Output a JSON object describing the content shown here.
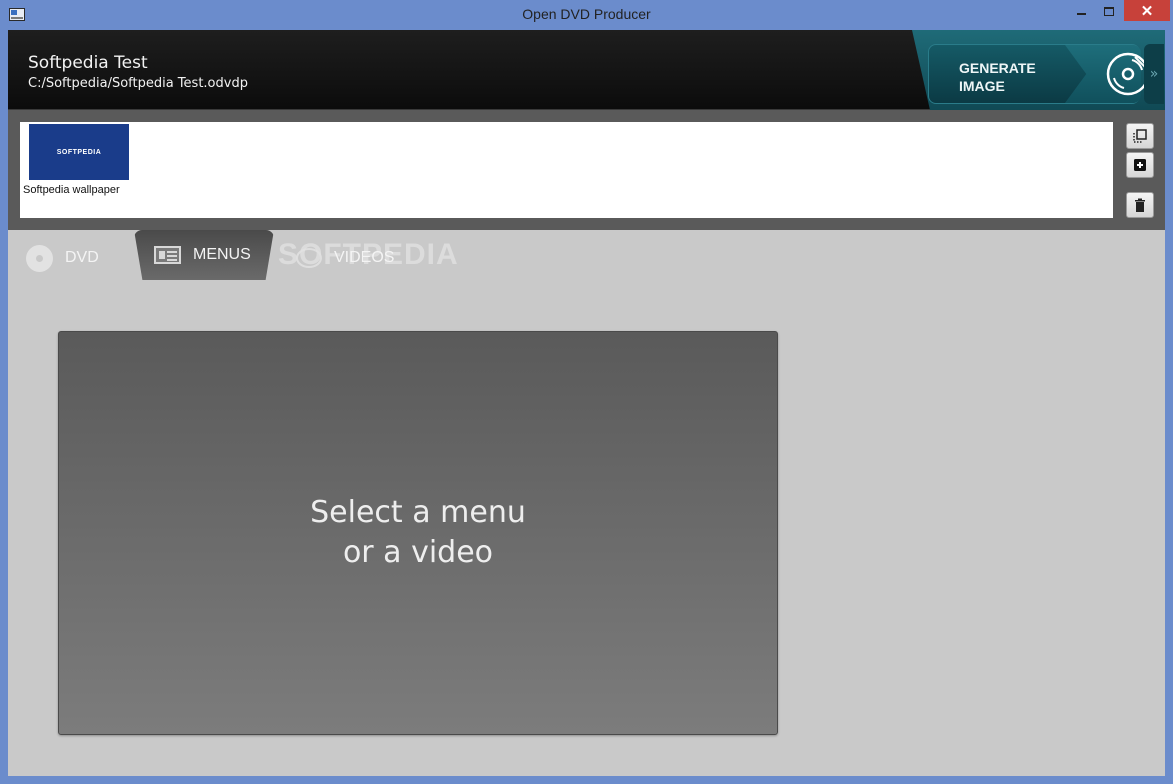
{
  "window": {
    "title": "Open DVD Producer",
    "close_glyph": "✕"
  },
  "header": {
    "project_name": "Softpedia Test",
    "project_path": "C:/Softpedia/Softpedia Test.odvdp",
    "generate_label_line1": "GENERATE",
    "generate_label_line2": "IMAGE",
    "expand_glyph": "»",
    "generate_icon": "disc-burn-icon"
  },
  "gallery": {
    "items": [
      {
        "thumb_text": "SOFTPEDIA",
        "label": "Softpedia wallpaper"
      }
    ],
    "side_buttons": [
      "browse-icon",
      "add-icon",
      "trash-icon"
    ]
  },
  "tabs": [
    {
      "label": "DVD",
      "icon": "disc-icon",
      "active": false
    },
    {
      "label": "MENUS",
      "icon": "menu-list-icon",
      "active": true
    },
    {
      "label": "VIDEOS",
      "icon": "video-icon",
      "active": false
    }
  ],
  "watermark": "SOFTPEDIA",
  "preview": {
    "message_line1": "Select a menu",
    "message_line2": "or a video"
  },
  "colors": {
    "titlebar": "#6b8ccc",
    "close": "#c7413a",
    "header": "#111111",
    "generate": "#155a66",
    "thumb": "#1a3c8a"
  }
}
